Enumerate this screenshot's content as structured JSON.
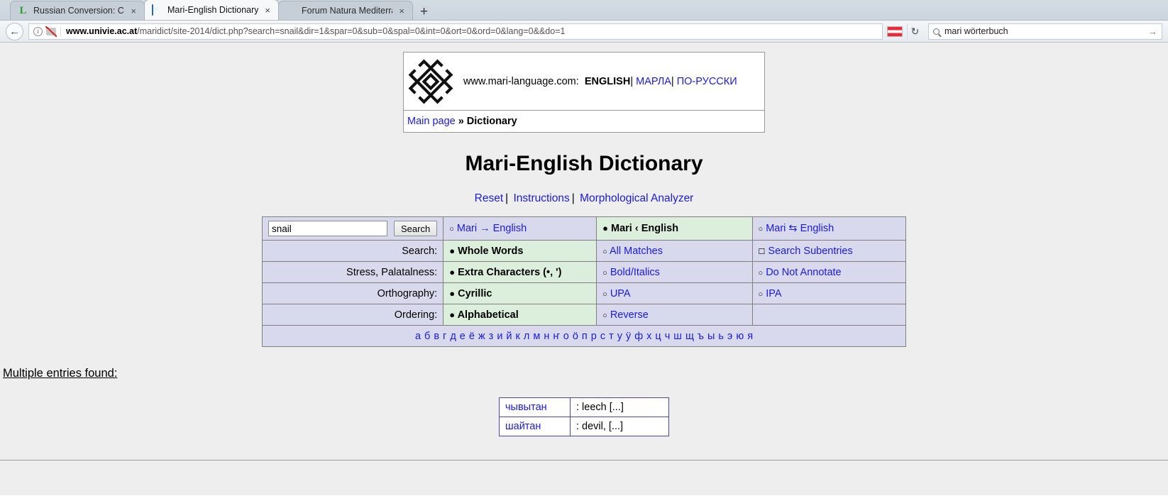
{
  "browser": {
    "tabs": [
      {
        "title": "Russian Conversion: Cyrillic",
        "icon": "letter-l-icon",
        "active": false,
        "close": "×"
      },
      {
        "title": "Mari-English Dictionary",
        "icon": "document-icon",
        "active": true,
        "close": "×"
      },
      {
        "title": "Forum Natura Mediterraneo",
        "icon": "nut-icon",
        "active": false,
        "close": "×"
      }
    ],
    "new_tab_label": "+",
    "back_arrow": "←",
    "url": {
      "domain": "www.univie.ac.at",
      "path": "/maridict/site-2014/dict.php?search=snail&dir=1&spar=0&sub=0&spal=0&int=0&ort=0&ord=0&lang=0&&do=1"
    },
    "reload_glyph": "↻",
    "search": {
      "value": "mari wörterbuch",
      "go_glyph": "→"
    }
  },
  "site_header": {
    "site_url": "www.mari-language.com:",
    "lang_links": [
      {
        "label": "ENGLISH",
        "active": true
      },
      {
        "label": "МАРЛА",
        "active": false
      },
      {
        "label": "ПО-РУССКИ",
        "active": false
      }
    ],
    "separator": "|",
    "breadcrumb": {
      "home": "Main page",
      "arrow": "»",
      "current": "Dictionary"
    }
  },
  "page": {
    "title": "Mari-English Dictionary",
    "top_links": [
      {
        "label": "Reset"
      },
      {
        "label": "Instructions"
      },
      {
        "label": "Morphological Analyzer"
      }
    ],
    "top_links_separator": "|"
  },
  "search_form": {
    "input_value": "snail",
    "input_placeholder": "",
    "submit_label": "Search",
    "direction_options": [
      {
        "label": "Mari → English",
        "selected": false,
        "marker": "○"
      },
      {
        "label": "Mari ‹ English",
        "selected": true,
        "marker": "●"
      },
      {
        "label": "Mari ⇆ English",
        "selected": false,
        "marker": "○"
      }
    ]
  },
  "options_rows": [
    {
      "label": "Search:",
      "choices": [
        {
          "label": "Whole Words",
          "selected": true,
          "marker": "●"
        },
        {
          "label": "All Matches",
          "selected": false,
          "marker": "○"
        },
        {
          "label": "Search Subentries",
          "selected": false,
          "marker": "☐"
        }
      ]
    },
    {
      "label": "Stress, Palatalness:",
      "choices": [
        {
          "label": "Extra Characters (•, ')",
          "selected": true,
          "marker": "●"
        },
        {
          "label": "Bold/Italics",
          "selected": false,
          "marker": "○"
        },
        {
          "label": "Do Not Annotate",
          "selected": false,
          "marker": "○"
        }
      ]
    },
    {
      "label": "Orthography:",
      "choices": [
        {
          "label": "Cyrillic",
          "selected": true,
          "marker": "●"
        },
        {
          "label": "UPA",
          "selected": false,
          "marker": "○"
        },
        {
          "label": "IPA",
          "selected": false,
          "marker": "○"
        }
      ]
    },
    {
      "label": "Ordering:",
      "choices": [
        {
          "label": "Alphabetical",
          "selected": true,
          "marker": "●"
        },
        {
          "label": "Reverse",
          "selected": false,
          "marker": "○"
        },
        {
          "label": "",
          "selected": false,
          "marker": ""
        }
      ]
    }
  ],
  "alphabet": [
    "а",
    "б",
    "в",
    "г",
    "д",
    "е",
    "ё",
    "ж",
    "з",
    "и",
    "й",
    "к",
    "л",
    "м",
    "н",
    "ҥ",
    "о",
    "ö",
    "п",
    "р",
    "с",
    "т",
    "у",
    "ӱ",
    "ф",
    "х",
    "ц",
    "ч",
    "ш",
    "щ",
    "ъ",
    "ы",
    "ь",
    "э",
    "ю",
    "я"
  ],
  "results": {
    "heading": "Multiple entries found:",
    "rows": [
      {
        "headword": "чывытан",
        "gloss": ": leech [...]"
      },
      {
        "headword": "шайтан",
        "gloss": ": devil, [...]"
      }
    ]
  },
  "colors": {
    "link": "#1a1ae6",
    "table_bg": "#d9d9ee",
    "selected_bg": "#dcefdc",
    "page_bg": "#eeeeee"
  }
}
